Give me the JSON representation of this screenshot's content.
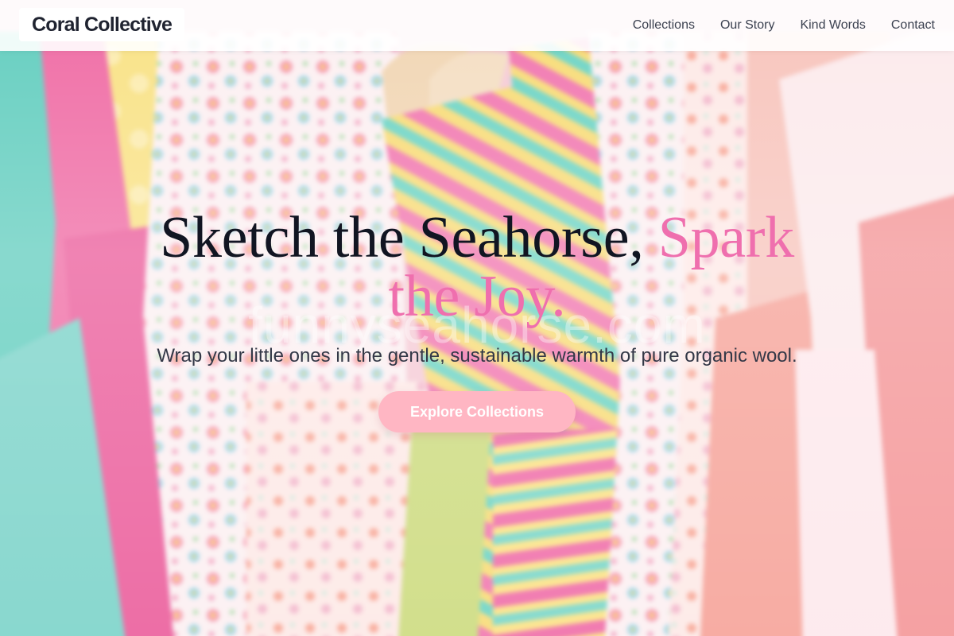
{
  "nav": {
    "brand": "Coral Collective",
    "links": [
      "Collections",
      "Our Story",
      "Kind Words",
      "Contact"
    ]
  },
  "hero": {
    "title_main": "Sketch the Seahorse,",
    "title_accent": "Spark the Joy.",
    "subtitle": "Wrap your little ones in the gentle, sustainable warmth of pure organic wool.",
    "cta_label": "Explore Collections",
    "watermark": "funnyseahorse.com"
  },
  "colors": {
    "accent_pink": "#ef6fae",
    "cta_bg": "#ffb6c3",
    "heading": "#111522"
  }
}
